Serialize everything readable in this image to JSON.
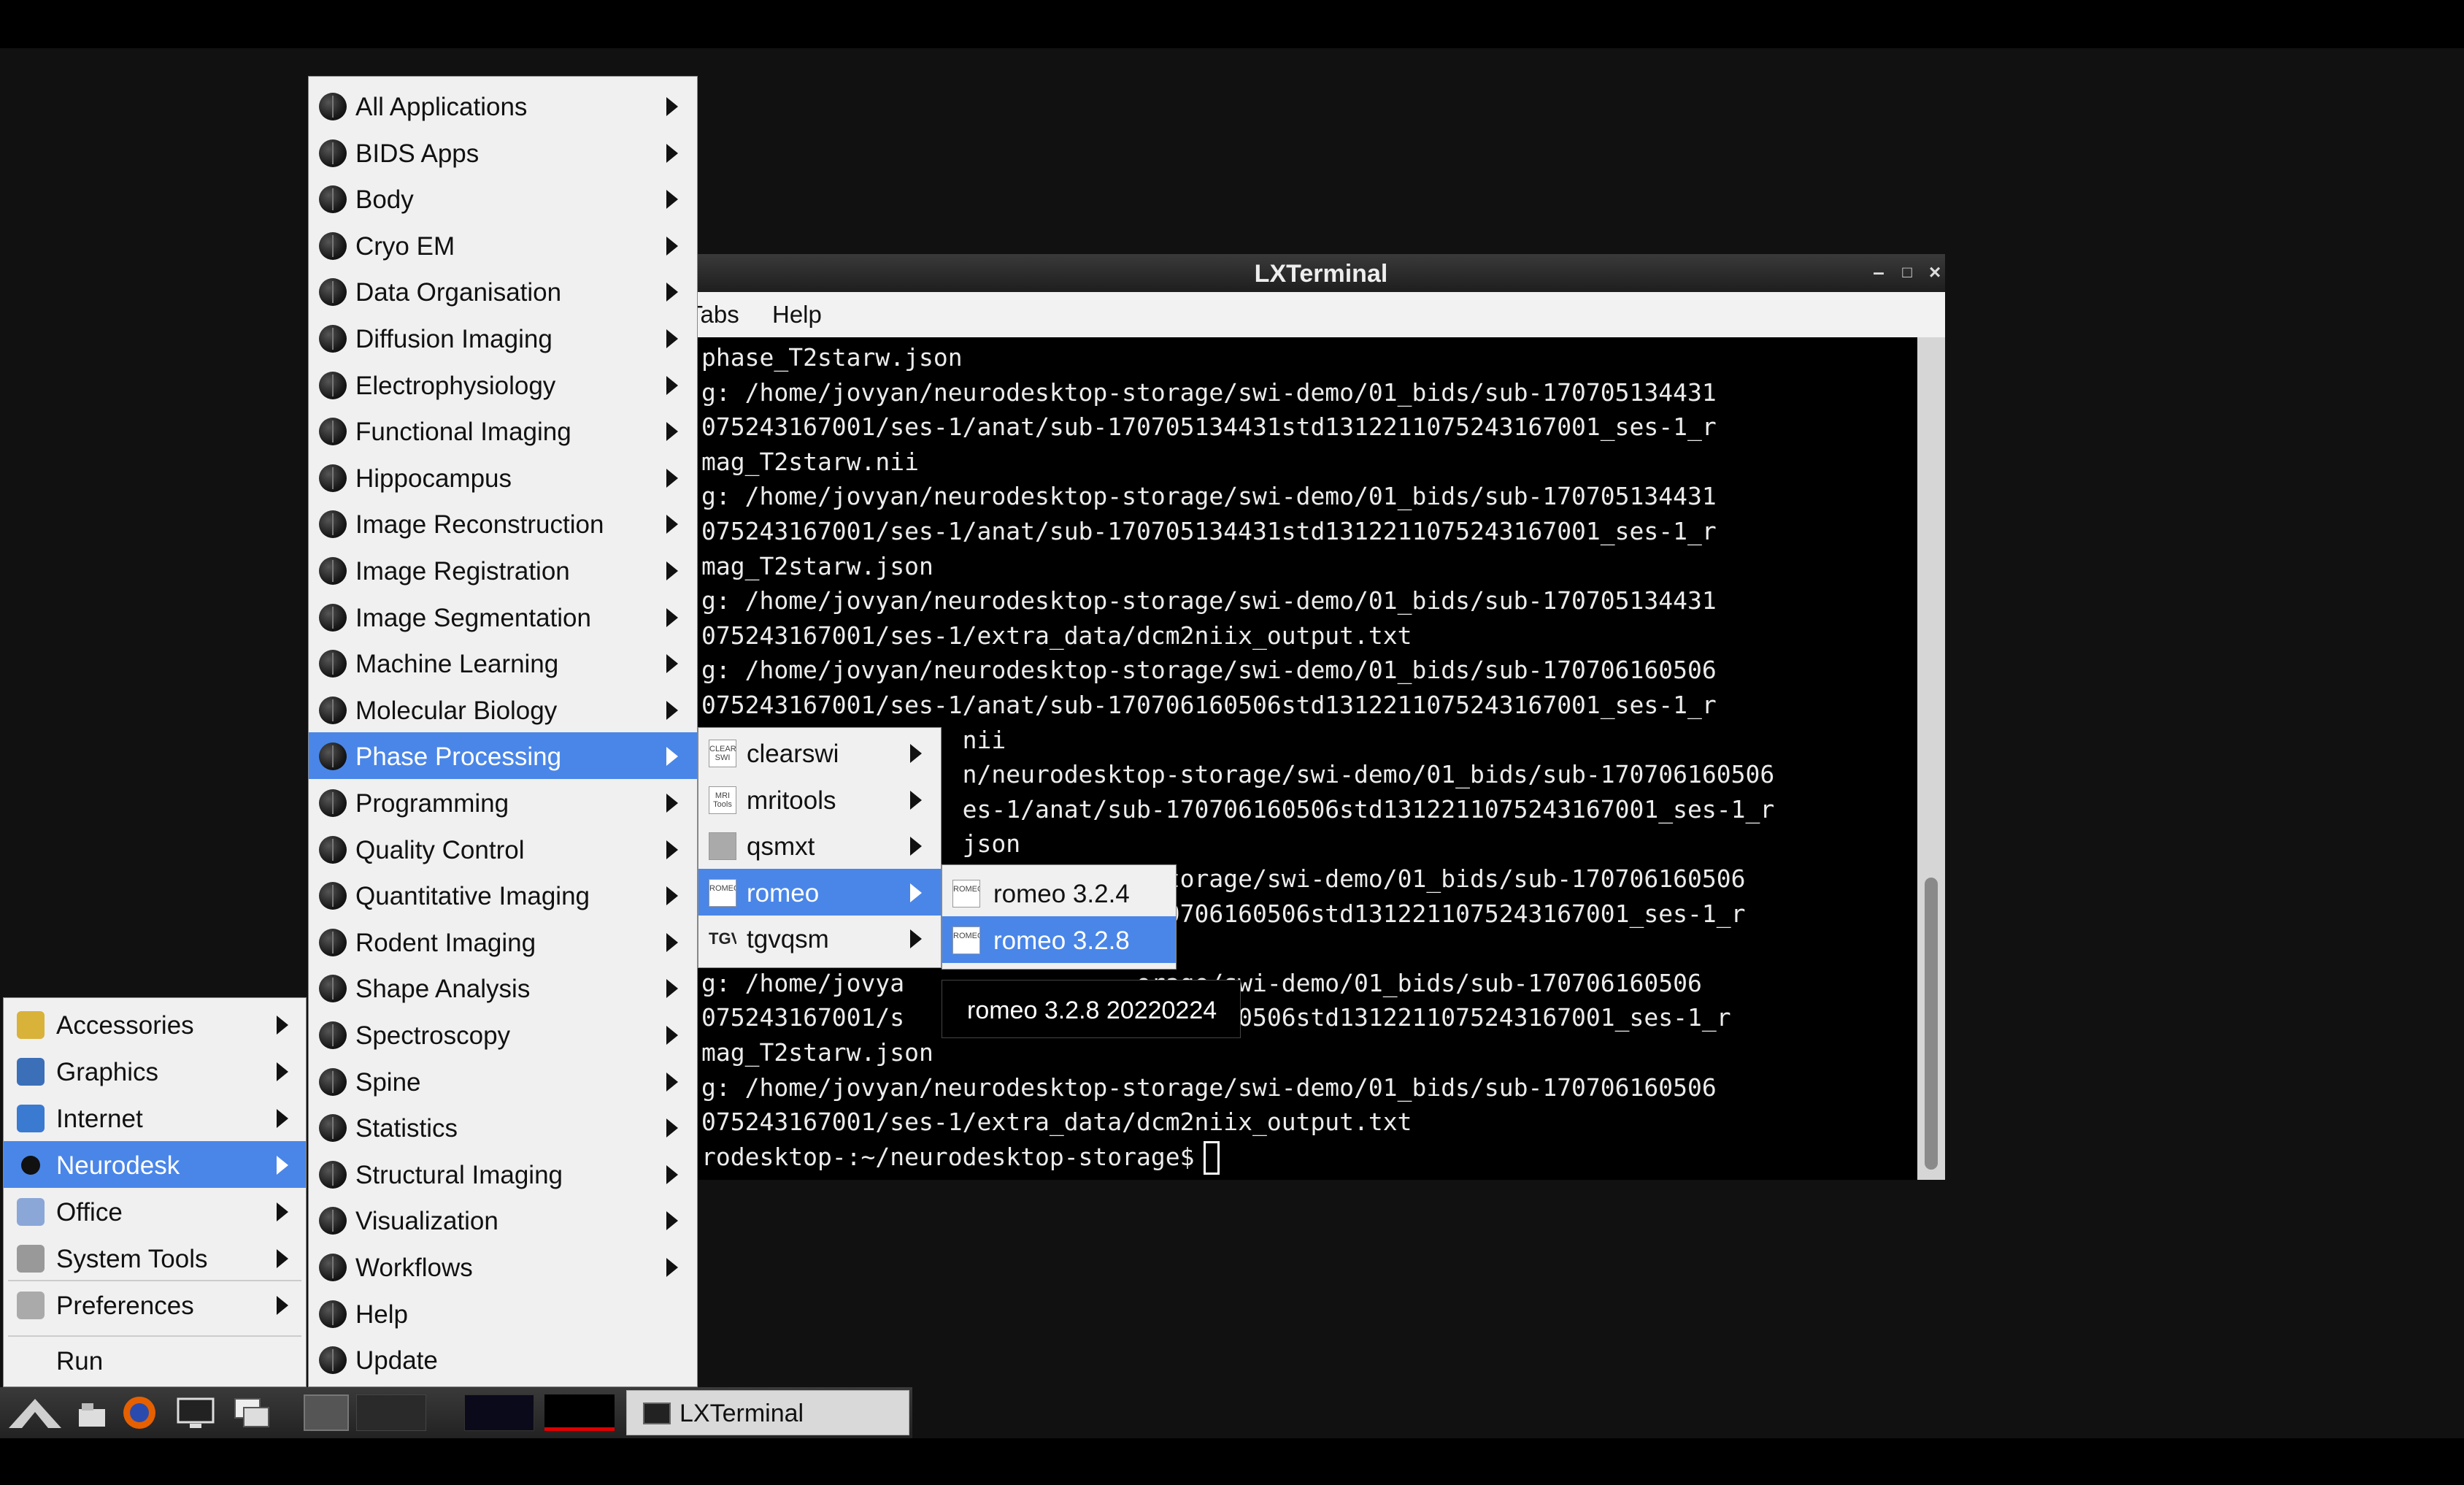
{
  "terminal": {
    "title": "LXTerminal",
    "menu": [
      "Tabs",
      "Help"
    ],
    "lines": [
      "phase_T2starw.json",
      "g: /home/jovyan/neurodesktop-storage/swi-demo/01_bids/sub-170705134431",
      "075243167001/ses-1/anat/sub-170705134431std1312211075243167001_ses-1_r",
      "mag_T2starw.nii",
      "g: /home/jovyan/neurodesktop-storage/swi-demo/01_bids/sub-170705134431",
      "075243167001/ses-1/anat/sub-170705134431std1312211075243167001_ses-1_r",
      "mag_T2starw.json",
      "g: /home/jovyan/neurodesktop-storage/swi-demo/01_bids/sub-170705134431",
      "075243167001/ses-1/extra_data/dcm2niix_output.txt",
      "g: /home/jovyan/neurodesktop-storage/swi-demo/01_bids/sub-170706160506",
      "075243167001/ses-1/anat/sub-170706160506std1312211075243167001_ses-1_r",
      "                  nii",
      "                  n/neurodesktop-storage/swi-demo/01_bids/sub-170706160506",
      "                  es-1/anat/sub-170706160506std1312211075243167001_ses-1_r",
      "                  json",
      "                             p-storage/swi-demo/01_bids/sub-170706160506",
      "                             -170706160506std1312211075243167001_ses-1_r",
      "",
      "g: /home/jovya                orage/swi-demo/01_bids/sub-170706160506",
      "075243167001/s                  706160506std1312211075243167001_ses-1_r",
      "mag_T2starw.json",
      "g: /home/jovyan/neurodesktop-storage/swi-demo/01_bids/sub-170706160506",
      "075243167001/ses-1/extra_data/dcm2niix_output.txt",
      "rodesktop-:~/neurodesktop-storage$"
    ]
  },
  "app_menu": {
    "items": [
      {
        "label": "Accessories",
        "icon": "accessories-icon",
        "arrow": true
      },
      {
        "label": "Graphics",
        "icon": "graphics-icon",
        "arrow": true
      },
      {
        "label": "Internet",
        "icon": "internet-icon",
        "arrow": true
      },
      {
        "label": "Neurodesk",
        "icon": "neurodesk-icon",
        "arrow": true,
        "selected": true
      },
      {
        "label": "Office",
        "icon": "office-icon",
        "arrow": true
      },
      {
        "label": "System Tools",
        "icon": "system-tools-icon",
        "arrow": true
      },
      {
        "label": "Preferences",
        "icon": "preferences-icon",
        "arrow": true
      },
      {
        "label": "Run",
        "icon": "",
        "arrow": false
      }
    ]
  },
  "neurodesk_menu": {
    "items": [
      {
        "label": "All Applications",
        "arrow": true
      },
      {
        "label": "BIDS Apps",
        "arrow": true
      },
      {
        "label": "Body",
        "arrow": true
      },
      {
        "label": "Cryo EM",
        "arrow": true
      },
      {
        "label": "Data Organisation",
        "arrow": true
      },
      {
        "label": "Diffusion Imaging",
        "arrow": true
      },
      {
        "label": "Electrophysiology",
        "arrow": true
      },
      {
        "label": "Functional Imaging",
        "arrow": true
      },
      {
        "label": "Hippocampus",
        "arrow": true
      },
      {
        "label": "Image Reconstruction",
        "arrow": true
      },
      {
        "label": "Image Registration",
        "arrow": true
      },
      {
        "label": "Image Segmentation",
        "arrow": true
      },
      {
        "label": "Machine Learning",
        "arrow": true
      },
      {
        "label": "Molecular Biology",
        "arrow": true
      },
      {
        "label": "Phase Processing",
        "arrow": true,
        "selected": true
      },
      {
        "label": "Programming",
        "arrow": true
      },
      {
        "label": "Quality Control",
        "arrow": true
      },
      {
        "label": "Quantitative Imaging",
        "arrow": true
      },
      {
        "label": "Rodent Imaging",
        "arrow": true
      },
      {
        "label": "Shape Analysis",
        "arrow": true
      },
      {
        "label": "Spectroscopy",
        "arrow": true
      },
      {
        "label": "Spine",
        "arrow": true
      },
      {
        "label": "Statistics",
        "arrow": true
      },
      {
        "label": "Structural Imaging",
        "arrow": true
      },
      {
        "label": "Visualization",
        "arrow": true
      },
      {
        "label": "Workflows",
        "arrow": true
      },
      {
        "label": "Help",
        "arrow": false
      },
      {
        "label": "Update",
        "arrow": false
      }
    ]
  },
  "phase_menu": {
    "items": [
      {
        "label": "clearswi",
        "icon_text": "CLEAR SWI",
        "arrow": true
      },
      {
        "label": "mritools",
        "icon_text": "MRI Tools",
        "arrow": true
      },
      {
        "label": "qsmxt",
        "icon_text": "",
        "arrow": true
      },
      {
        "label": "romeo",
        "icon_text": "ROMEO",
        "arrow": true,
        "selected": true
      },
      {
        "label": "tgvqsm",
        "icon_text": "TGV",
        "arrow": true
      }
    ]
  },
  "romeo_menu": {
    "items": [
      {
        "label": "romeo 3.2.4",
        "icon_text": "ROMEO"
      },
      {
        "label": "romeo 3.2.8",
        "icon_text": "ROMEO",
        "selected": true
      }
    ]
  },
  "tooltip": {
    "text": "romeo 3.2.8 20220224"
  },
  "taskbar": {
    "task_label": "LXTerminal"
  },
  "colors": {
    "selection": "#4a86e8",
    "menu_bg": "#f0f0f0",
    "terminal_bg": "#000000"
  }
}
